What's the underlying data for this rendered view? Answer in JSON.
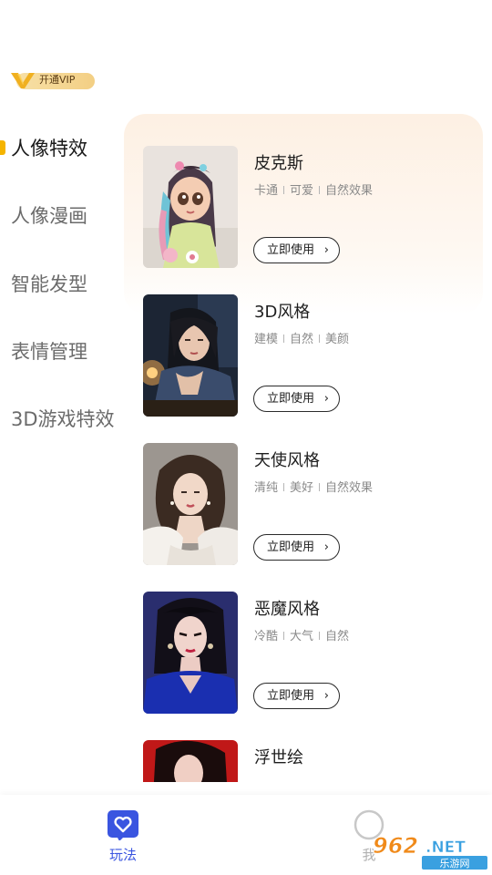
{
  "vip": {
    "label": "开通VIP"
  },
  "categories": [
    {
      "label": "人像特效",
      "active": true
    },
    {
      "label": "人像漫画",
      "active": false
    },
    {
      "label": "智能发型",
      "active": false
    },
    {
      "label": "表情管理",
      "active": false
    },
    {
      "label": "3D游戏特效",
      "active": false
    }
  ],
  "effects": [
    {
      "title": "皮克斯",
      "tags": [
        "卡通",
        "可爱",
        "自然效果"
      ],
      "button": "立即使用",
      "image": "cartoon-girl"
    },
    {
      "title": "3D风格",
      "tags": [
        "建模",
        "自然",
        "美颜"
      ],
      "button": "立即使用",
      "image": "night-portrait"
    },
    {
      "title": "天使风格",
      "tags": [
        "清纯",
        "美好",
        "自然效果"
      ],
      "button": "立即使用",
      "image": "angel-portrait"
    },
    {
      "title": "恶魔风格",
      "tags": [
        "冷酷",
        "大气",
        "自然"
      ],
      "button": "立即使用",
      "image": "blue-portrait"
    },
    {
      "title": "浮世绘",
      "tags": [],
      "button": "",
      "image": "red-portrait"
    }
  ],
  "tabs": [
    {
      "label": "玩法",
      "icon": "heart-icon",
      "active": true
    },
    {
      "label": "我",
      "icon": "profile-icon",
      "active": false
    }
  ],
  "watermark": {
    "number": "962",
    "suffix": ".NET",
    "subtitle": "乐游网"
  },
  "colors": {
    "accent": "#3a55e0",
    "indicator": "#f5b400",
    "vip_gold": "#f3cf84"
  }
}
